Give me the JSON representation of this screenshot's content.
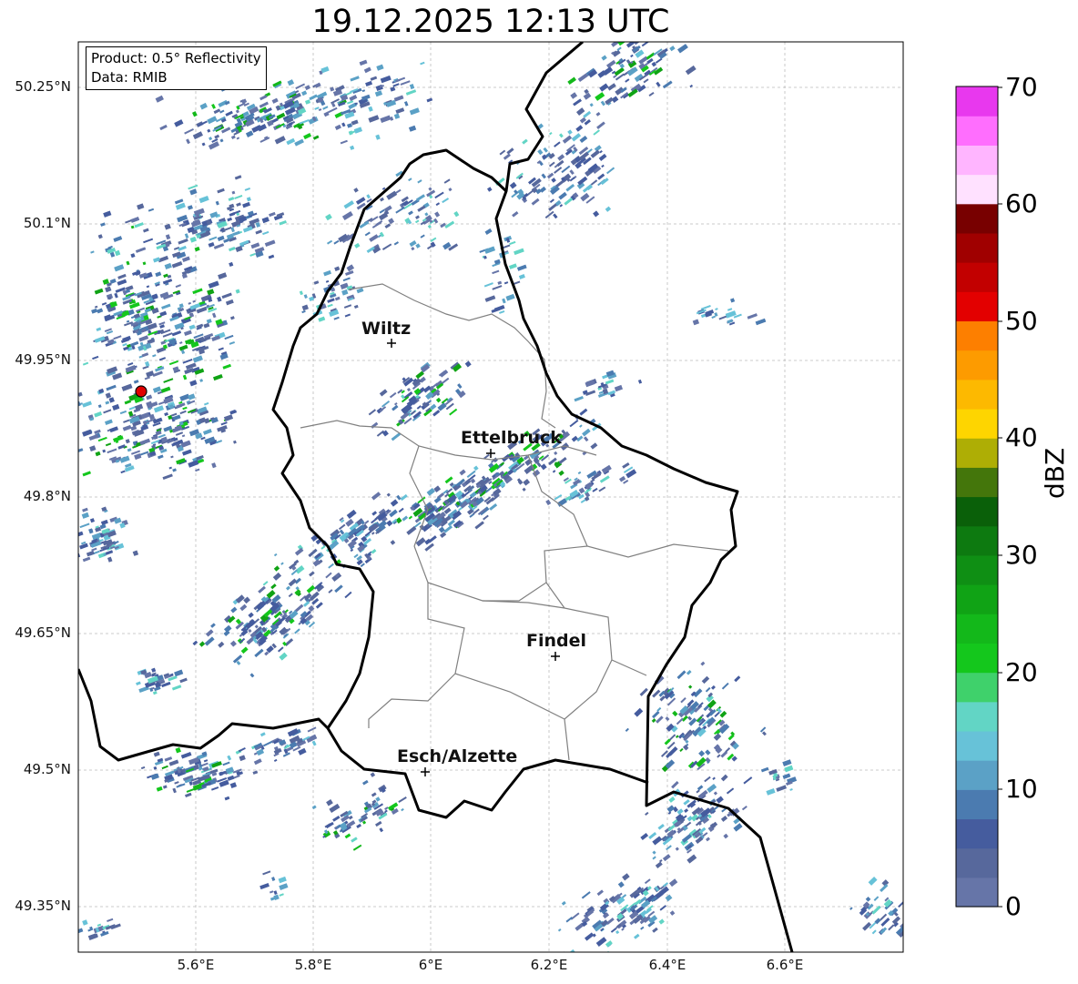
{
  "title": "19.12.2025 12:13 UTC",
  "info": {
    "product": "Product: 0.5° Reflectivity",
    "data": "Data: RMIB"
  },
  "lat_ticks": [
    "50.25°N",
    "50.1°N",
    "49.95°N",
    "49.8°N",
    "49.65°N",
    "49.5°N",
    "49.35°N"
  ],
  "lon_ticks": [
    "5.6°E",
    "5.8°E",
    "6°E",
    "6.2°E",
    "6.4°E",
    "6.6°E"
  ],
  "cities": [
    "Wiltz",
    "Ettelbruck",
    "Findel",
    "Esch/Alzette"
  ],
  "colorbar": {
    "label": "dBZ",
    "ticks": [
      "70",
      "60",
      "50",
      "40",
      "30",
      "20",
      "10",
      "0"
    ],
    "range": [
      0,
      70
    ],
    "colors": [
      "#6675a8",
      "#57689c",
      "#455c9e",
      "#4b7bb0",
      "#5ba1c6",
      "#67c2d8",
      "#62d5c5",
      "#3fd16b",
      "#14c71c",
      "#13b81a",
      "#10a315",
      "#0f8f14",
      "#0d7a10",
      "#0a6009",
      "#44760b",
      "#aeae05",
      "#fed500",
      "#fdb900",
      "#fd9b00",
      "#fd7f00",
      "#e30000",
      "#c20000",
      "#a00000",
      "#780000",
      "#ffe1ff",
      "#ffb5ff",
      "#ff6efe",
      "#e838ee"
    ]
  },
  "radar_site": {
    "color": "#e00000"
  }
}
